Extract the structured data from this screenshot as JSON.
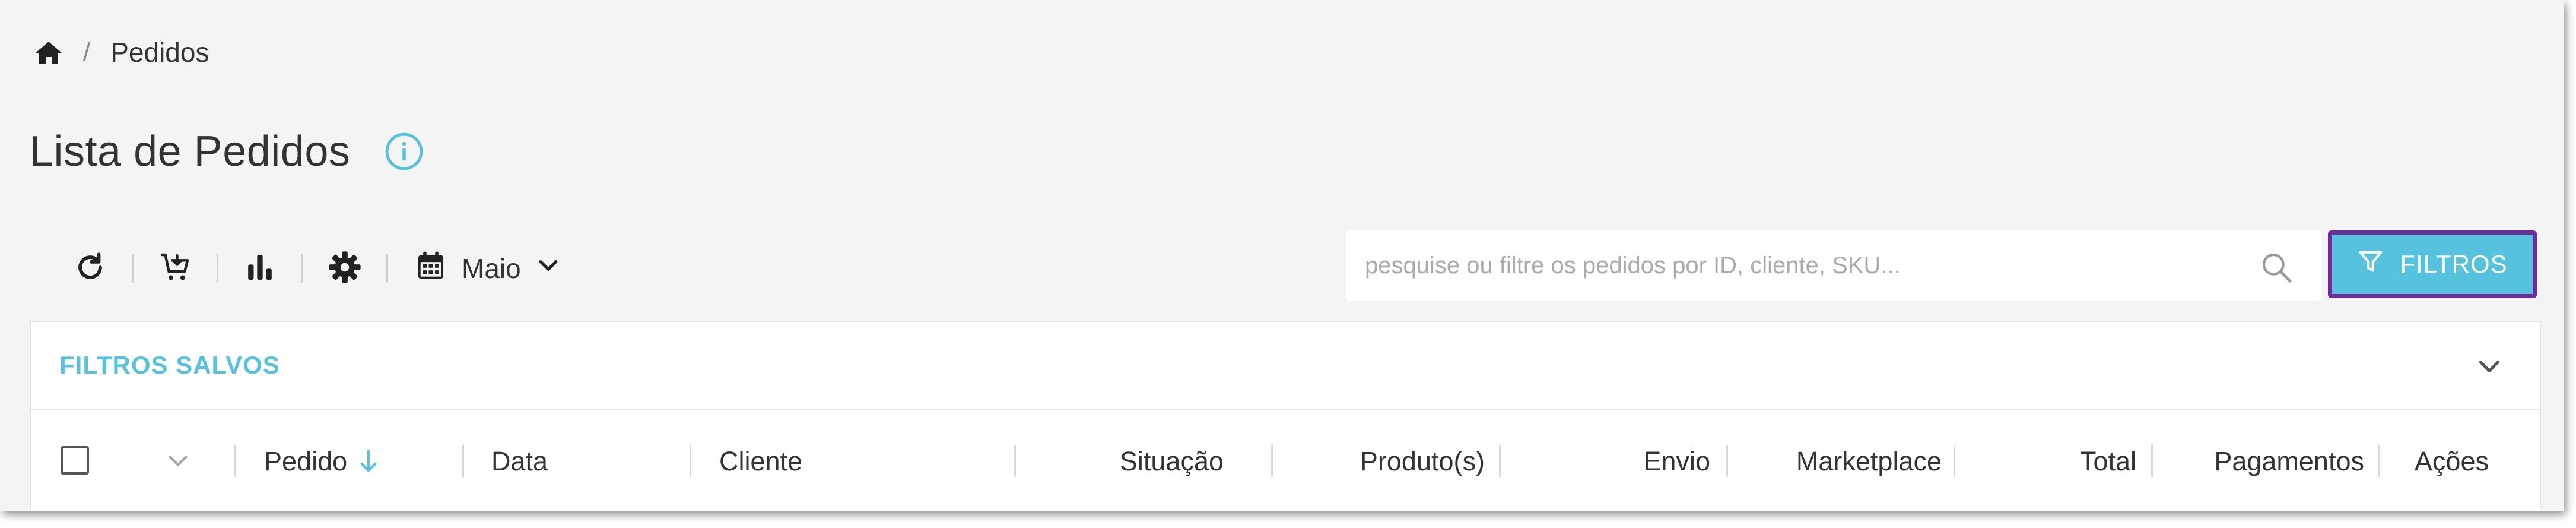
{
  "breadcrumb": {
    "home_icon": "home-icon",
    "separator": "/",
    "current": "Pedidos"
  },
  "header": {
    "title": "Lista de Pedidos",
    "info_icon": "info-icon"
  },
  "toolbar": {
    "icons": [
      "refresh-icon",
      "cart-icon",
      "chart-icon",
      "gear-icon",
      "calendar-icon"
    ],
    "month_label": "Maio"
  },
  "search": {
    "placeholder": "pesquise ou filtre os pedidos por ID, cliente, SKU...",
    "value": ""
  },
  "filters_button": {
    "label": "FILTROS",
    "bg_color": "#57c2de",
    "border_color": "#6d2c9a"
  },
  "saved_filters": {
    "label": "FILTROS SALVOS",
    "color": "#57c2de"
  },
  "table": {
    "columns": {
      "pedido": "Pedido",
      "data": "Data",
      "cliente": "Cliente",
      "situacao": "Situação",
      "produtos": "Produto(s)",
      "envio": "Envio",
      "marketplace": "Marketplace",
      "total": "Total",
      "pagamentos": "Pagamentos",
      "acoes": "Ações"
    }
  }
}
